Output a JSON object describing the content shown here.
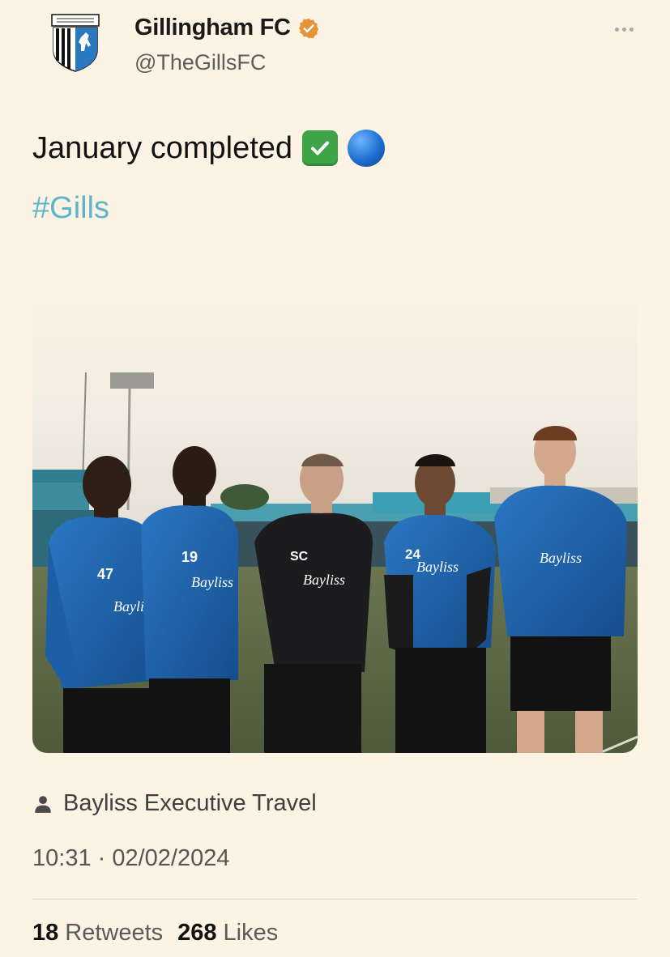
{
  "account": {
    "display_name": "Gillingham FC",
    "handle": "@TheGillsFC",
    "avatar_icon": "gillingham-fc-crest",
    "verified_icon": "verified-badge-icon",
    "verified_color": "#e8923a"
  },
  "tweet": {
    "text": "January completed",
    "emojis": [
      "check-mark-button",
      "blue-circle"
    ],
    "hashtag": "#Gills"
  },
  "media": {
    "description_icon": "photo",
    "jersey_numbers": [
      "47",
      "19",
      "24"
    ],
    "coach_initials": "SC",
    "sponsor": "Bayliss"
  },
  "tagged": {
    "icon": "person-icon",
    "label": "Bayliss Executive Travel"
  },
  "meta": {
    "timestamp": "10:31 · 02/02/2024"
  },
  "stats": {
    "retweets_count": "18",
    "retweets_label": "Retweets",
    "likes_count": "268",
    "likes_label": "Likes"
  },
  "colors": {
    "background": "#fcf3e4",
    "hashtag": "#5cb5c8",
    "kit_blue": "#1d5fa6"
  }
}
